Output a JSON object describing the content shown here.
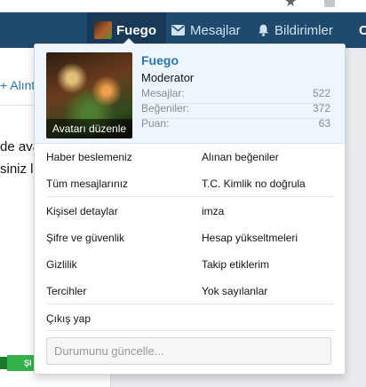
{
  "navbar": {
    "user_label": "Fuego",
    "messages_label": "Mesajlar",
    "alerts_label": "Bildirimler",
    "cut_label": "C"
  },
  "background": {
    "link_text": "+ Alıntı",
    "text_line1": "de ava",
    "text_line2": "siniz l",
    "green_button": "ŞI"
  },
  "user_menu": {
    "avatar_edit_label": "Avatarı düzenle",
    "username": "Fuego",
    "user_title": "Moderator",
    "stats": [
      {
        "label": "Mesajlar:",
        "value": "522"
      },
      {
        "label": "Beğeniler:",
        "value": "372"
      },
      {
        "label": "Puan:",
        "value": "63"
      }
    ],
    "links_left": [
      "Haber beslemeniz",
      "Tüm mesajlarınız",
      "Kişisel detaylar",
      "Şifre ve güvenlik",
      "Gizlilik",
      "Tercihler"
    ],
    "links_right": [
      "Alınan beğeniler",
      "T.C. Kimlik no doğrula",
      "imza",
      "Hesap yükseltmeleri",
      "Takip etiklerim",
      "Yok sayılanlar"
    ],
    "logout_label": "Çıkış yap",
    "status_placeholder": "Durumunu güncelle..."
  },
  "colors": {
    "navbar": "#1f4a6e",
    "navbar_active": "#183a58",
    "link_accent": "#2577b1",
    "popup_header": "#edf6fd"
  }
}
